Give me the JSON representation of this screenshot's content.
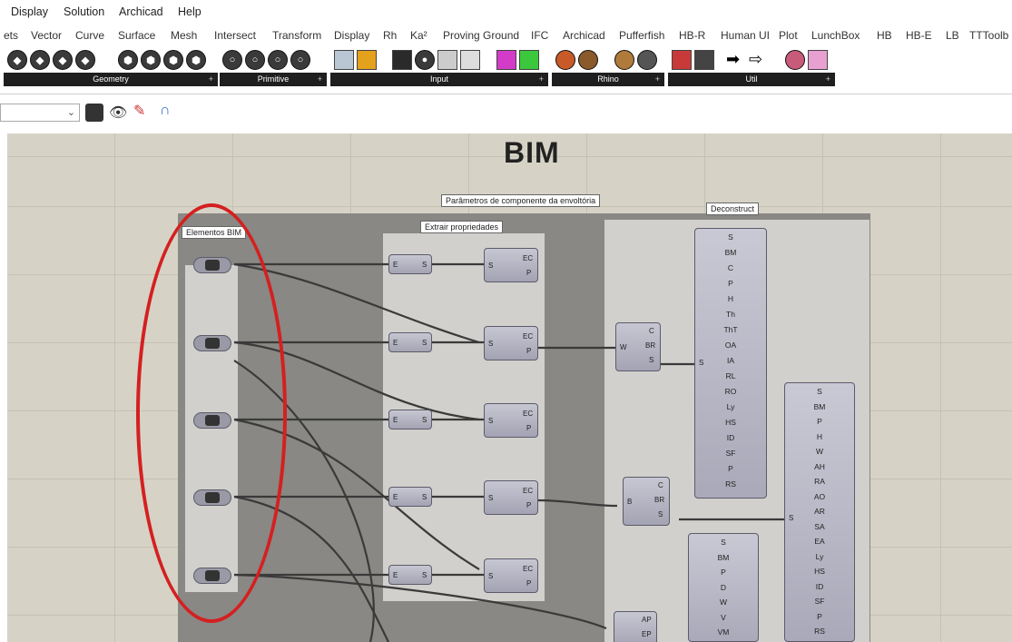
{
  "menubar": {
    "items": [
      "Display",
      "Solution",
      "Archicad",
      "Help"
    ]
  },
  "tabs": [
    "ets",
    "Vector",
    "Curve",
    "Surface",
    "Mesh",
    "Intersect",
    "Transform",
    "Display",
    "Rh",
    "Ka²",
    "Proving Ground",
    "IFC",
    "Archicad",
    "Pufferfish",
    "HB-R",
    "Human UI",
    "Plot",
    "LunchBox",
    "HB",
    "HB-E",
    "LB",
    "TTToolb"
  ],
  "toolbar_groups": [
    "Geometry",
    "Primitive",
    "Input",
    "Rhino",
    "Util"
  ],
  "canvas": {
    "title": "BIM",
    "groups": {
      "elementos": "Elementos BIM",
      "parametros": "Parâmetros de componente da envoltória",
      "extrair": "Extrair propriedades",
      "deconstruct": "Deconstruct"
    },
    "extract_inputs": {
      "in": "E",
      "out": "S"
    },
    "prop_ports": {
      "in": "S",
      "out1": "EC",
      "out2": "P"
    },
    "wall_node": {
      "in": "W",
      "outs": [
        "C",
        "BR",
        "S"
      ]
    },
    "beam_node": {
      "in": "B",
      "outs": [
        "C",
        "BR",
        "S"
      ]
    },
    "node3": {
      "outs": [
        "AP",
        "EP"
      ]
    },
    "stack1": [
      "S",
      "BM",
      "C",
      "P",
      "H",
      "Th",
      "ThT",
      "OA",
      "IA",
      "RL",
      "RO",
      "Ly",
      "HS",
      "ID",
      "SF",
      "P",
      "RS"
    ],
    "stack2": [
      "S",
      "BM",
      "P",
      "H",
      "W",
      "AH",
      "RA",
      "AO",
      "AR",
      "SA",
      "EA",
      "Ly",
      "HS",
      "ID",
      "SF",
      "P",
      "RS"
    ],
    "stack3": [
      "S",
      "BM",
      "P",
      "D",
      "W",
      "V",
      "VM"
    ],
    "stack_in": "S"
  }
}
